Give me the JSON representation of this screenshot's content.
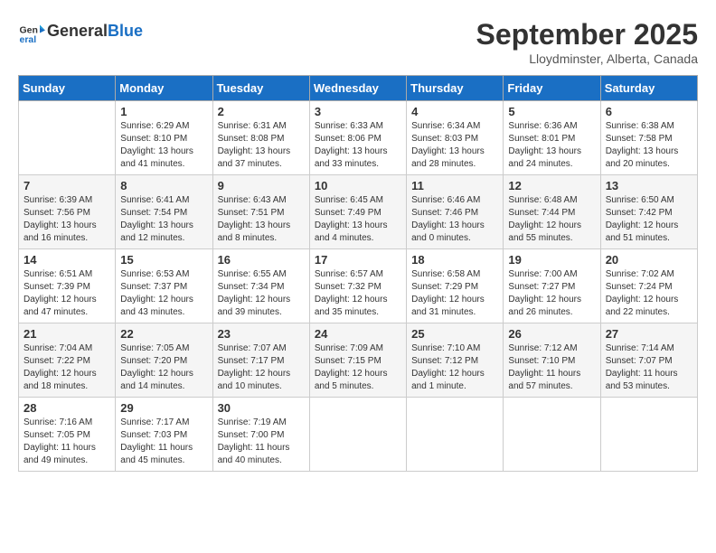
{
  "header": {
    "logo_line1": "General",
    "logo_line2": "Blue",
    "month_title": "September 2025",
    "location": "Lloydminster, Alberta, Canada"
  },
  "days_of_week": [
    "Sunday",
    "Monday",
    "Tuesday",
    "Wednesday",
    "Thursday",
    "Friday",
    "Saturday"
  ],
  "weeks": [
    [
      {
        "day": "",
        "info": ""
      },
      {
        "day": "1",
        "info": "Sunrise: 6:29 AM\nSunset: 8:10 PM\nDaylight: 13 hours\nand 41 minutes."
      },
      {
        "day": "2",
        "info": "Sunrise: 6:31 AM\nSunset: 8:08 PM\nDaylight: 13 hours\nand 37 minutes."
      },
      {
        "day": "3",
        "info": "Sunrise: 6:33 AM\nSunset: 8:06 PM\nDaylight: 13 hours\nand 33 minutes."
      },
      {
        "day": "4",
        "info": "Sunrise: 6:34 AM\nSunset: 8:03 PM\nDaylight: 13 hours\nand 28 minutes."
      },
      {
        "day": "5",
        "info": "Sunrise: 6:36 AM\nSunset: 8:01 PM\nDaylight: 13 hours\nand 24 minutes."
      },
      {
        "day": "6",
        "info": "Sunrise: 6:38 AM\nSunset: 7:58 PM\nDaylight: 13 hours\nand 20 minutes."
      }
    ],
    [
      {
        "day": "7",
        "info": "Sunrise: 6:39 AM\nSunset: 7:56 PM\nDaylight: 13 hours\nand 16 minutes."
      },
      {
        "day": "8",
        "info": "Sunrise: 6:41 AM\nSunset: 7:54 PM\nDaylight: 13 hours\nand 12 minutes."
      },
      {
        "day": "9",
        "info": "Sunrise: 6:43 AM\nSunset: 7:51 PM\nDaylight: 13 hours\nand 8 minutes."
      },
      {
        "day": "10",
        "info": "Sunrise: 6:45 AM\nSunset: 7:49 PM\nDaylight: 13 hours\nand 4 minutes."
      },
      {
        "day": "11",
        "info": "Sunrise: 6:46 AM\nSunset: 7:46 PM\nDaylight: 13 hours\nand 0 minutes."
      },
      {
        "day": "12",
        "info": "Sunrise: 6:48 AM\nSunset: 7:44 PM\nDaylight: 12 hours\nand 55 minutes."
      },
      {
        "day": "13",
        "info": "Sunrise: 6:50 AM\nSunset: 7:42 PM\nDaylight: 12 hours\nand 51 minutes."
      }
    ],
    [
      {
        "day": "14",
        "info": "Sunrise: 6:51 AM\nSunset: 7:39 PM\nDaylight: 12 hours\nand 47 minutes."
      },
      {
        "day": "15",
        "info": "Sunrise: 6:53 AM\nSunset: 7:37 PM\nDaylight: 12 hours\nand 43 minutes."
      },
      {
        "day": "16",
        "info": "Sunrise: 6:55 AM\nSunset: 7:34 PM\nDaylight: 12 hours\nand 39 minutes."
      },
      {
        "day": "17",
        "info": "Sunrise: 6:57 AM\nSunset: 7:32 PM\nDaylight: 12 hours\nand 35 minutes."
      },
      {
        "day": "18",
        "info": "Sunrise: 6:58 AM\nSunset: 7:29 PM\nDaylight: 12 hours\nand 31 minutes."
      },
      {
        "day": "19",
        "info": "Sunrise: 7:00 AM\nSunset: 7:27 PM\nDaylight: 12 hours\nand 26 minutes."
      },
      {
        "day": "20",
        "info": "Sunrise: 7:02 AM\nSunset: 7:24 PM\nDaylight: 12 hours\nand 22 minutes."
      }
    ],
    [
      {
        "day": "21",
        "info": "Sunrise: 7:04 AM\nSunset: 7:22 PM\nDaylight: 12 hours\nand 18 minutes."
      },
      {
        "day": "22",
        "info": "Sunrise: 7:05 AM\nSunset: 7:20 PM\nDaylight: 12 hours\nand 14 minutes."
      },
      {
        "day": "23",
        "info": "Sunrise: 7:07 AM\nSunset: 7:17 PM\nDaylight: 12 hours\nand 10 minutes."
      },
      {
        "day": "24",
        "info": "Sunrise: 7:09 AM\nSunset: 7:15 PM\nDaylight: 12 hours\nand 5 minutes."
      },
      {
        "day": "25",
        "info": "Sunrise: 7:10 AM\nSunset: 7:12 PM\nDaylight: 12 hours\nand 1 minute."
      },
      {
        "day": "26",
        "info": "Sunrise: 7:12 AM\nSunset: 7:10 PM\nDaylight: 11 hours\nand 57 minutes."
      },
      {
        "day": "27",
        "info": "Sunrise: 7:14 AM\nSunset: 7:07 PM\nDaylight: 11 hours\nand 53 minutes."
      }
    ],
    [
      {
        "day": "28",
        "info": "Sunrise: 7:16 AM\nSunset: 7:05 PM\nDaylight: 11 hours\nand 49 minutes."
      },
      {
        "day": "29",
        "info": "Sunrise: 7:17 AM\nSunset: 7:03 PM\nDaylight: 11 hours\nand 45 minutes."
      },
      {
        "day": "30",
        "info": "Sunrise: 7:19 AM\nSunset: 7:00 PM\nDaylight: 11 hours\nand 40 minutes."
      },
      {
        "day": "",
        "info": ""
      },
      {
        "day": "",
        "info": ""
      },
      {
        "day": "",
        "info": ""
      },
      {
        "day": "",
        "info": ""
      }
    ]
  ]
}
